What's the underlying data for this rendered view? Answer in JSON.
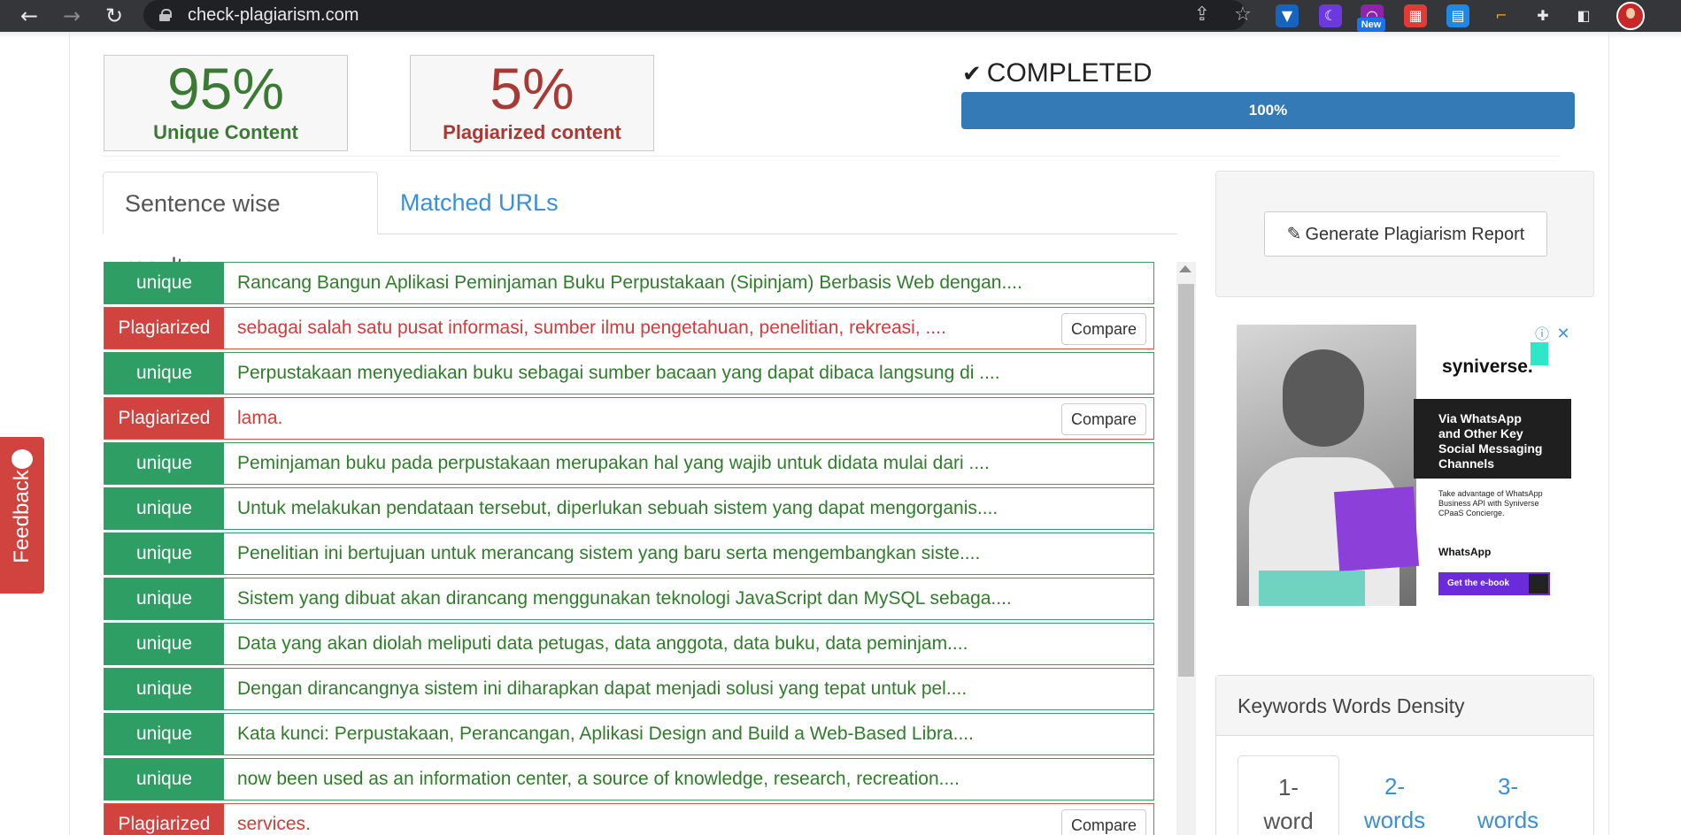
{
  "browser": {
    "url": "check-plagiarism.com",
    "new_badge": "New",
    "colors": {
      "toolbar": "#35363a",
      "omnibox": "#202124"
    }
  },
  "summary": {
    "unique_percent": "95%",
    "unique_label": "Unique Content",
    "plagiarized_percent": "5%",
    "plagiarized_label": "Plagiarized content",
    "status": "COMPLETED",
    "progress_label": "100%",
    "progress_value": 1.0
  },
  "tabs": {
    "sentence_wise": "Sentence wise results",
    "matched_urls": "Matched URLs"
  },
  "results": [
    {
      "status": "unique",
      "text": "Rancang Bangun Aplikasi Peminjaman Buku Perpustakaan (Sipinjam) Berbasis Web dengan...."
    },
    {
      "status": "Plagiarized",
      "text": "sebagai salah satu pusat informasi, sumber ilmu pengetahuan, penelitian, rekreasi, ....",
      "compare": "Compare"
    },
    {
      "status": "unique",
      "text": "Perpustakaan menyediakan buku sebagai sumber bacaan yang dapat dibaca langsung di ...."
    },
    {
      "status": "Plagiarized",
      "text": "lama.",
      "compare": "Compare"
    },
    {
      "status": "unique",
      "text": "Peminjaman buku pada perpustakaan merupakan hal yang wajib untuk didata mulai dari ...."
    },
    {
      "status": "unique",
      "text": "Untuk melakukan pendataan tersebut, diperlukan sebuah sistem yang dapat mengorganis...."
    },
    {
      "status": "unique",
      "text": "Penelitian ini bertujuan untuk merancang sistem yang baru serta mengembangkan siste...."
    },
    {
      "status": "unique",
      "text": "Sistem yang dibuat akan dirancang menggunakan teknologi JavaScript dan MySQL sebaga...."
    },
    {
      "status": "unique",
      "text": "Data yang akan diolah meliputi data petugas, data anggota, data buku, data peminjam...."
    },
    {
      "status": "unique",
      "text": "Dengan dirancangnya sistem ini diharapkan dapat menjadi solusi yang tepat untuk pel...."
    },
    {
      "status": "unique",
      "text": "Kata kunci: Perpustakaan, Perancangan, Aplikasi Design and Build a Web-Based Libra...."
    },
    {
      "status": "unique",
      "text": "now been used as an information center, a source of knowledge, research, recreation...."
    },
    {
      "status": "Plagiarized",
      "text": "services.",
      "compare": "Compare"
    }
  ],
  "feedback_label": "Feedback",
  "report_button": "Generate Plagiarism Report",
  "ad": {
    "brand": "syniverse.",
    "headline": "Via WhatsApp\nand Other Key\nSocial Messaging\nChannels",
    "body": "Take advantage of WhatsApp Business API with Syniverse CPaaS Concierge.",
    "whatsapp": "WhatsApp",
    "cta": "Get the e-book"
  },
  "keywords": {
    "title": "Keywords Words Density",
    "tabs": [
      "1-\nword",
      "2-\nwords",
      "3-\nwords"
    ]
  },
  "colors": {
    "unique": "#2e9e65",
    "plagiarized": "#d0433f",
    "progress": "#337ab7",
    "link": "#3b8fd6"
  }
}
